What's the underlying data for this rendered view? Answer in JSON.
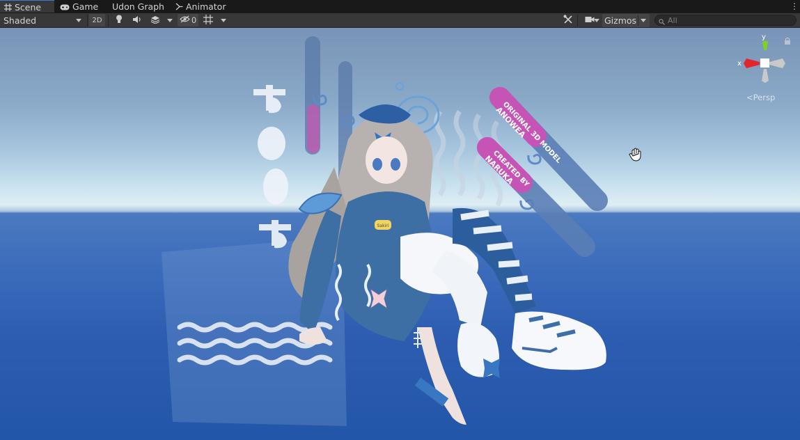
{
  "tabs": [
    {
      "label": "Scene",
      "icon": "grid-icon",
      "active": true
    },
    {
      "label": "Game",
      "icon": "gamepad-icon",
      "active": false
    },
    {
      "label": "Udon Graph",
      "icon": "",
      "active": false
    },
    {
      "label": "Animator",
      "icon": "animator-icon",
      "active": false
    }
  ],
  "toolbar": {
    "draw_mode": "Shaded",
    "mode_2d": "2D",
    "hidden_count": "0",
    "gizmos": "Gizmos",
    "search_placeholder": "All"
  },
  "orientation_gizmo": {
    "x_label": "x",
    "y_label": "y",
    "projection": "Persp",
    "colors": {
      "x": "#e3242b",
      "y": "#7ed321",
      "z": "#c8c8c8"
    }
  },
  "scene": {
    "sign_top_line1": "ORIGINAL 3D MODEL",
    "sign_top_line2": "ANOWEA",
    "sign_bottom_line1": "CREATED BY",
    "sign_bottom_line2": "NARUKA",
    "badge_text": "Sakiri",
    "sky_color": "#8aa9c8",
    "horizon_color": "#dfeef5",
    "water_color": "#3c6cbc"
  }
}
